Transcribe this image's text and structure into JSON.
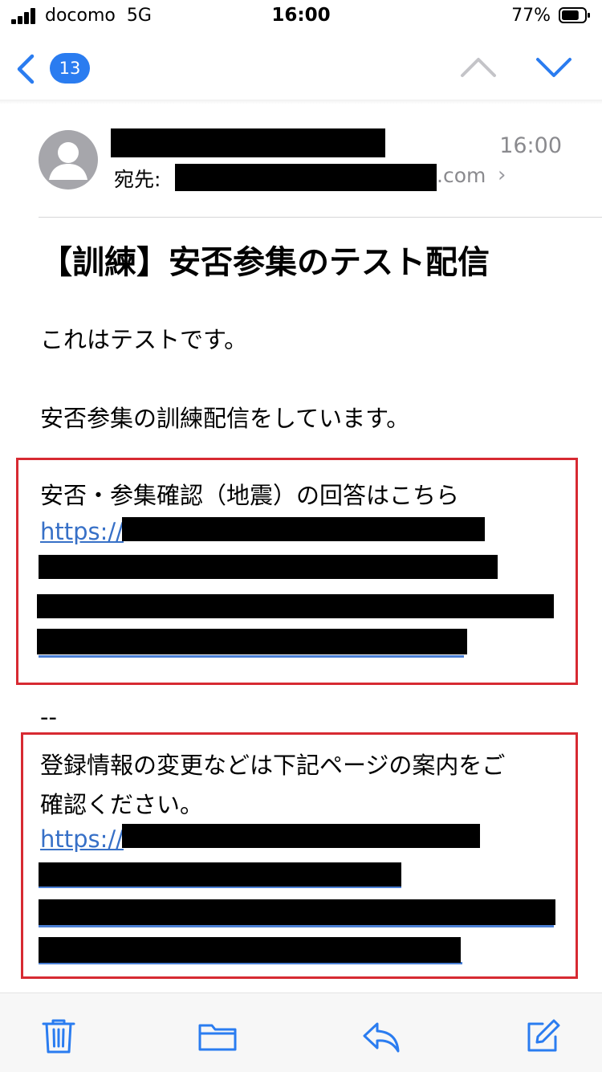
{
  "status_bar": {
    "carrier": "docomo",
    "network": "5G",
    "time": "16:00",
    "battery_percent": "77%",
    "battery_level": 0.77
  },
  "nav": {
    "unread_count": "13",
    "accent_color": "#2a7cf0"
  },
  "mail": {
    "time": "16:00",
    "to_label": "宛先:",
    "to_domain_suffix": ".com",
    "to_chevron": "›",
    "subject": "【訓練】安否参集のテスト配信",
    "body_line_1": "これはテストです。",
    "body_line_2": "安否参集の訓練配信をしています。",
    "box1_title": "安否・参集確認（地震）の回答はこちら",
    "link_prefix_1": "https://",
    "separator": "--",
    "box2_line_1": "登録情報の変更などは下記ページの案内をご",
    "box2_line_2": "確認ください。",
    "link_prefix_2": "https://"
  },
  "toolbar": {
    "items": [
      "trash-icon",
      "folder-icon",
      "reply-icon",
      "compose-icon"
    ]
  },
  "colors": {
    "highlight": "#d72a32",
    "link": "#3770c7",
    "icon": "#2a7cf0"
  }
}
